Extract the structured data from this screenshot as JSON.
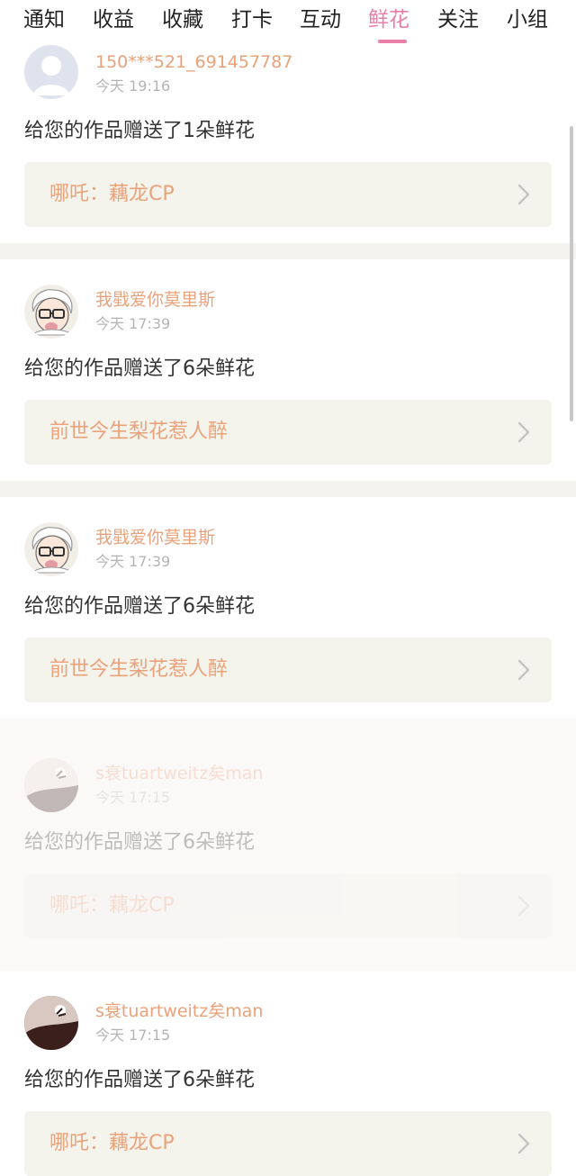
{
  "tabs": [
    {
      "label": "通知",
      "active": false
    },
    {
      "label": "收益",
      "active": false
    },
    {
      "label": "收藏",
      "active": false
    },
    {
      "label": "打卡",
      "active": false
    },
    {
      "label": "互动",
      "active": false
    },
    {
      "label": "鲜花",
      "active": true
    },
    {
      "label": "关注",
      "active": false
    },
    {
      "label": "小组",
      "active": false
    }
  ],
  "colors": {
    "accent_pink": "#e77fa8",
    "name_orange": "#e9a27a",
    "card_bg": "#f4f4ec",
    "separator": "#f4f3f0"
  },
  "notifications": [
    {
      "user": "150***521_691457787",
      "time": "今天 19:16",
      "message": "给您的作品赠送了1朵鲜花",
      "work": "哪吒：藕龙CP",
      "avatar": "default-avatar-icon"
    },
    {
      "user": "我戥爱你莫里斯",
      "time": "今天 17:39",
      "message": "给您的作品赠送了6朵鲜花",
      "work": "前世今生梨花惹人醉",
      "avatar": "cartoon-avatar"
    },
    {
      "user": "我戥爱你莫里斯",
      "time": "今天 17:39",
      "message": "给您的作品赠送了6朵鲜花",
      "work": "前世今生梨花惹人醉",
      "avatar": "cartoon-avatar"
    },
    {
      "user": "s衰tuartweitz矣man",
      "time": "今天 17:15",
      "message": "给您的作品赠送了6朵鲜花",
      "work": "哪吒：藕龙CP",
      "avatar": "photo-avatar"
    },
    {
      "user": "s衰tuartweitz矣man",
      "time": "今天 17:15",
      "message": "给您的作品赠送了6朵鲜花",
      "work": "哪吒：藕龙CP",
      "avatar": "photo-avatar"
    }
  ]
}
